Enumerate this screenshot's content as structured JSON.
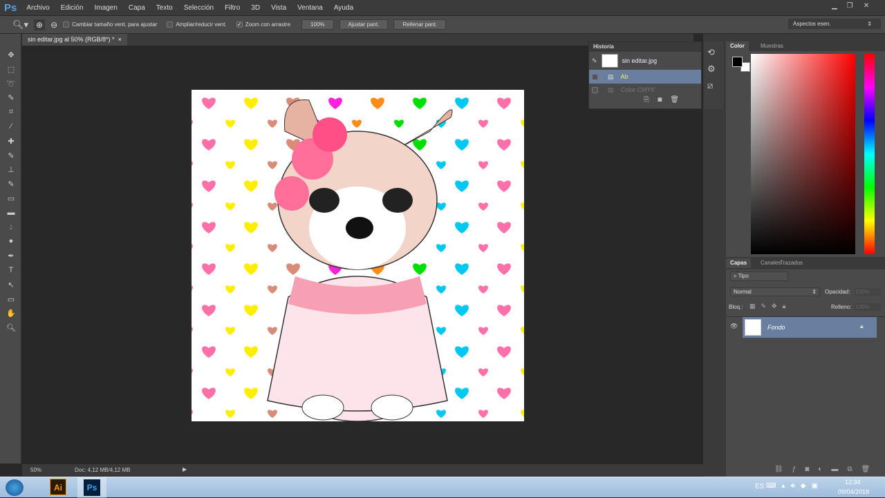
{
  "app": {
    "logo": "Ps",
    "menu": [
      "Archivo",
      "Edición",
      "Imagen",
      "Capa",
      "Texto",
      "Selección",
      "Filtro",
      "3D",
      "Vista",
      "Ventana",
      "Ayuda"
    ]
  },
  "options": {
    "resize_windows": "Cambiar tamaño vent. para ajustar",
    "zoom_all": "Ampliar/reducir vent.",
    "scrubby_zoom": "Zoom con arrastre",
    "btn_100": "100%",
    "btn_fit": "Ajustar pant.",
    "btn_fill": "Rellenar pant.",
    "workspace": "Aspectos esen."
  },
  "document": {
    "tab": "sin editar.jpg al 50% (RGB/8*) *",
    "close": "×"
  },
  "status": {
    "zoom": "50%",
    "doc": "Doc: 4,12 MB/4,12 MB"
  },
  "history": {
    "title": "Historia",
    "snapshot": "sin editar.jpg",
    "items": [
      "Ab",
      "Color CMYK"
    ]
  },
  "color_panel": {
    "tabs": [
      "Color",
      "Muestras"
    ]
  },
  "layers_panel": {
    "tabs": [
      "Capas",
      "Canales",
      "Trazados"
    ],
    "filter": "Tipo",
    "blend": "Normal",
    "opacity_label": "Opacidad:",
    "opacity": "100%",
    "lock_label": "Bloq.:",
    "fill_label": "Relleno:",
    "fill": "100%",
    "layers": [
      {
        "name": "Fondo"
      }
    ]
  },
  "taskbar": {
    "lang": "ES",
    "time": "12:34",
    "date": "09/04/2018"
  },
  "heart_colors": [
    "#ff6fa8",
    "#00e000",
    "#ff22dd",
    "#ffee00",
    "#00c8f0",
    "#ff8c1a",
    "#d98c78"
  ]
}
